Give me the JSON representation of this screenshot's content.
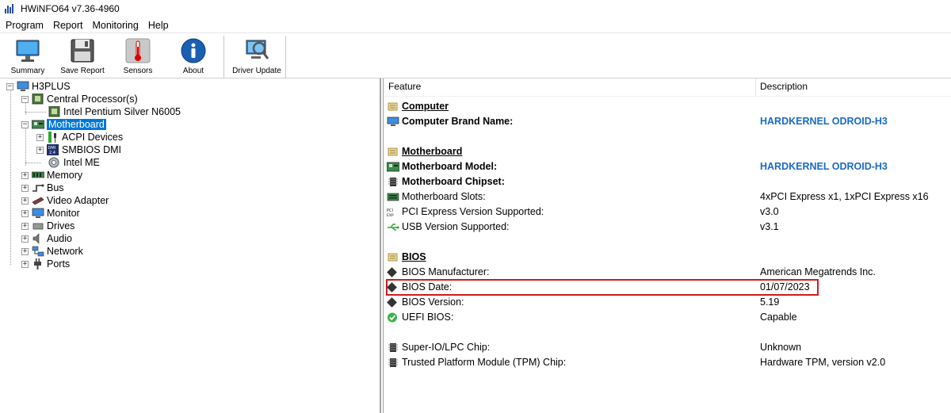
{
  "window": {
    "title": "HWiNFO64 v7.36-4960"
  },
  "menu": [
    "Program",
    "Report",
    "Monitoring",
    "Help"
  ],
  "toolbar": {
    "summary": "Summary",
    "save_report": "Save Report",
    "sensors": "Sensors",
    "about": "About",
    "driver_update": "Driver Update"
  },
  "tree": {
    "root": "H3PLUS",
    "central_processor": "Central Processor(s)",
    "cpu": "Intel Pentium Silver N6005",
    "motherboard": "Motherboard",
    "acpi": "ACPI Devices",
    "smbios": "SMBIOS DMI",
    "intel_me": "Intel ME",
    "memory": "Memory",
    "bus": "Bus",
    "video_adapter": "Video Adapter",
    "monitor": "Monitor",
    "drives": "Drives",
    "audio": "Audio",
    "network": "Network",
    "ports": "Ports"
  },
  "details": {
    "col_feature": "Feature",
    "col_description": "Description",
    "computer": {
      "section": "Computer",
      "brand_label": "Computer Brand Name:",
      "brand_value": "HARDKERNEL ODROID-H3"
    },
    "motherboard": {
      "section": "Motherboard",
      "model_label": "Motherboard Model:",
      "model_value": "HARDKERNEL ODROID-H3",
      "chipset_label": "Motherboard Chipset:",
      "slots_label": "Motherboard Slots:",
      "slots_value": "4xPCI Express x1, 1xPCI Express x16",
      "pcie_label": "PCI Express Version Supported:",
      "pcie_value": "v3.0",
      "usb_label": "USB Version Supported:",
      "usb_value": "v3.1"
    },
    "bios": {
      "section": "BIOS",
      "manufacturer_label": "BIOS Manufacturer:",
      "manufacturer_value": "American Megatrends Inc.",
      "date_label": "BIOS Date:",
      "date_value": "01/07/2023",
      "version_label": "BIOS Version:",
      "version_value": "5.19",
      "uefi_label": "UEFI BIOS:",
      "uefi_value": "Capable"
    },
    "superio_label": "Super-IO/LPC Chip:",
    "superio_value": "Unknown",
    "tpm_label": "Trusted Platform Module (TPM) Chip:",
    "tpm_value": "Hardware TPM, version v2.0"
  },
  "colors": {
    "selection": "#0078d7",
    "link_value": "#1a6ac8",
    "highlight_box": "#d11a1a"
  }
}
